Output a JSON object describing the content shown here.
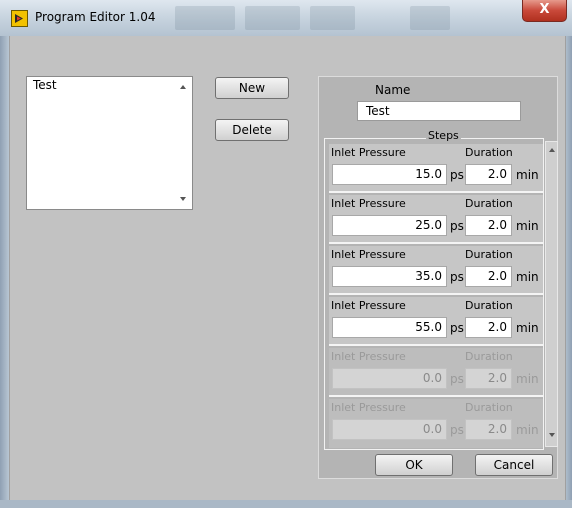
{
  "window": {
    "title": "Program Editor  1.04",
    "close_glyph": "X"
  },
  "program_list": {
    "items": [
      "Test"
    ]
  },
  "buttons": {
    "new_label": "New",
    "delete_label": "Delete",
    "ok_label": "OK",
    "cancel_label": "Cancel"
  },
  "editor": {
    "name_label": "Name",
    "name_value": "Test",
    "steps_label": "Steps",
    "steps": [
      {
        "pressure_label": "Inlet Pressure",
        "pressure": "15.0",
        "pressure_unit": "psi",
        "duration_label": "Duration",
        "duration": "2.0",
        "duration_unit": "min",
        "enabled": true
      },
      {
        "pressure_label": "Inlet Pressure",
        "pressure": "25.0",
        "pressure_unit": "psi",
        "duration_label": "Duration",
        "duration": "2.0",
        "duration_unit": "min",
        "enabled": true
      },
      {
        "pressure_label": "Inlet Pressure",
        "pressure": "35.0",
        "pressure_unit": "psi",
        "duration_label": "Duration",
        "duration": "2.0",
        "duration_unit": "min",
        "enabled": true
      },
      {
        "pressure_label": "Inlet Pressure",
        "pressure": "55.0",
        "pressure_unit": "psi",
        "duration_label": "Duration",
        "duration": "2.0",
        "duration_unit": "min",
        "enabled": true
      },
      {
        "pressure_label": "Inlet Pressure",
        "pressure": "0.0",
        "pressure_unit": "psi",
        "duration_label": "Duration",
        "duration": "2.0",
        "duration_unit": "min",
        "enabled": false
      },
      {
        "pressure_label": "Inlet Pressure",
        "pressure": "0.0",
        "pressure_unit": "psi",
        "duration_label": "Duration",
        "duration": "2.0",
        "duration_unit": "min",
        "enabled": false
      }
    ]
  },
  "colors": {
    "close_button": "#c9493a",
    "app_icon": "#f2c200",
    "panel_bg": "#b4b4b4",
    "window_bg": "#c2c2c2"
  }
}
